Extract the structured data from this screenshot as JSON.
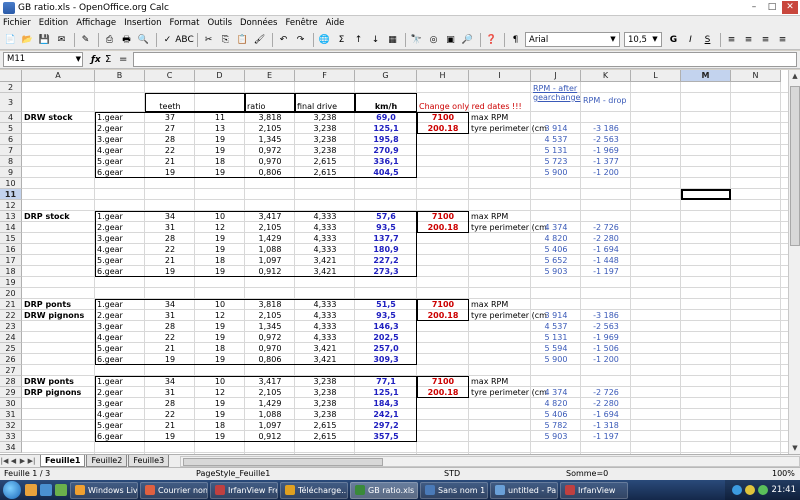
{
  "window": {
    "title": "GB ratio.xls - OpenOffice.org Calc"
  },
  "menu": [
    "Fichier",
    "Edition",
    "Affichage",
    "Insertion",
    "Format",
    "Outils",
    "Données",
    "Fenêtre",
    "Aide"
  ],
  "toolbar": {
    "font": "Arial",
    "size": "10,5",
    "bold": "G",
    "italic": "I",
    "underline": "S"
  },
  "namebox": {
    "value": "M11"
  },
  "formula": {
    "value": ""
  },
  "columns": [
    "A",
    "B",
    "C",
    "D",
    "E",
    "F",
    "G",
    "H",
    "I",
    "J",
    "K",
    "L",
    "M",
    "N"
  ],
  "selected_column": "M",
  "selected_row": "11",
  "rows": [
    "2",
    "3",
    "4",
    "5",
    "6",
    "7",
    "8",
    "9",
    "10",
    "11",
    "12",
    "13",
    "14",
    "15",
    "16",
    "17",
    "18",
    "19",
    "20",
    "21",
    "22",
    "23",
    "24",
    "25",
    "26",
    "27",
    "28",
    "29",
    "30",
    "31",
    "32",
    "33",
    "34"
  ],
  "headers": {
    "teeth": "teeth",
    "ratio": "ratio",
    "final_drive": "final drive",
    "kmh": "km/h",
    "change_only": "Change only red dates !!!",
    "rpm_after": "RPM - after gearchange",
    "rpm_drop": "RPM - drop"
  },
  "blocks": [
    {
      "title1": "DRW stock",
      "title2": "",
      "rows": [
        {
          "gear": "1.gear",
          "t1": "37",
          "t2": "11",
          "ratio": "3,818",
          "fd": "3,238",
          "kmh": "69,0",
          "h": "7100",
          "i": "max RPM",
          "j": "",
          "k": ""
        },
        {
          "gear": "2.gear",
          "t1": "27",
          "t2": "13",
          "ratio": "2,105",
          "fd": "3,238",
          "kmh": "125,1",
          "h": "200.18",
          "i": "tyre perimeter (cm",
          "j": "3 914",
          "k": "-3 186"
        },
        {
          "gear": "3.gear",
          "t1": "28",
          "t2": "19",
          "ratio": "1,345",
          "fd": "3,238",
          "kmh": "195,8",
          "h": "",
          "i": "",
          "j": "4 537",
          "k": "-2 563"
        },
        {
          "gear": "4.gear",
          "t1": "22",
          "t2": "19",
          "ratio": "0,972",
          "fd": "3,238",
          "kmh": "270,9",
          "h": "",
          "i": "",
          "j": "5 131",
          "k": "-1 969"
        },
        {
          "gear": "5.gear",
          "t1": "21",
          "t2": "18",
          "ratio": "0,970",
          "fd": "2,615",
          "kmh": "336,1",
          "h": "",
          "i": "",
          "j": "5 723",
          "k": "-1 377"
        },
        {
          "gear": "6.gear",
          "t1": "19",
          "t2": "19",
          "ratio": "0,806",
          "fd": "2,615",
          "kmh": "404,5",
          "h": "",
          "i": "",
          "j": "5 900",
          "k": "-1 200"
        }
      ]
    },
    {
      "title1": "DRP stock",
      "title2": "",
      "rows": [
        {
          "gear": "1.gear",
          "t1": "34",
          "t2": "10",
          "ratio": "3,417",
          "fd": "4,333",
          "kmh": "57,6",
          "h": "7100",
          "i": "max RPM",
          "j": "",
          "k": ""
        },
        {
          "gear": "2.gear",
          "t1": "31",
          "t2": "12",
          "ratio": "2,105",
          "fd": "4,333",
          "kmh": "93,5",
          "h": "200.18",
          "i": "tyre perimeter (cm",
          "j": "4 374",
          "k": "-2 726"
        },
        {
          "gear": "3.gear",
          "t1": "28",
          "t2": "19",
          "ratio": "1,429",
          "fd": "4,333",
          "kmh": "137,7",
          "h": "",
          "i": "",
          "j": "4 820",
          "k": "-2 280"
        },
        {
          "gear": "4.gear",
          "t1": "22",
          "t2": "19",
          "ratio": "1,088",
          "fd": "4,333",
          "kmh": "180,9",
          "h": "",
          "i": "",
          "j": "5 406",
          "k": "-1 694"
        },
        {
          "gear": "5.gear",
          "t1": "21",
          "t2": "18",
          "ratio": "1,097",
          "fd": "3,421",
          "kmh": "227,2",
          "h": "",
          "i": "",
          "j": "5 652",
          "k": "-1 448"
        },
        {
          "gear": "6.gear",
          "t1": "19",
          "t2": "19",
          "ratio": "0,912",
          "fd": "3,421",
          "kmh": "273,3",
          "h": "",
          "i": "",
          "j": "5 903",
          "k": "-1 197"
        }
      ]
    },
    {
      "title1": "DRP ponts",
      "title2": "DRW pignons",
      "rows": [
        {
          "gear": "1.gear",
          "t1": "34",
          "t2": "10",
          "ratio": "3,818",
          "fd": "4,333",
          "kmh": "51,5",
          "h": "7100",
          "i": "max RPM",
          "j": "",
          "k": ""
        },
        {
          "gear": "2.gear",
          "t1": "31",
          "t2": "12",
          "ratio": "2,105",
          "fd": "4,333",
          "kmh": "93,5",
          "h": "200.18",
          "i": "tyre perimeter (cm",
          "j": "3 914",
          "k": "-3 186"
        },
        {
          "gear": "3.gear",
          "t1": "28",
          "t2": "19",
          "ratio": "1,345",
          "fd": "4,333",
          "kmh": "146,3",
          "h": "",
          "i": "",
          "j": "4 537",
          "k": "-2 563"
        },
        {
          "gear": "4.gear",
          "t1": "22",
          "t2": "19",
          "ratio": "0,972",
          "fd": "4,333",
          "kmh": "202,5",
          "h": "",
          "i": "",
          "j": "5 131",
          "k": "-1 969"
        },
        {
          "gear": "5.gear",
          "t1": "21",
          "t2": "18",
          "ratio": "0,970",
          "fd": "3,421",
          "kmh": "257,0",
          "h": "",
          "i": "",
          "j": "5 594",
          "k": "-1 506"
        },
        {
          "gear": "6.gear",
          "t1": "19",
          "t2": "19",
          "ratio": "0,806",
          "fd": "3,421",
          "kmh": "309,3",
          "h": "",
          "i": "",
          "j": "5 900",
          "k": "-1 200"
        }
      ]
    },
    {
      "title1": "DRW ponts",
      "title2": "DRP pignons",
      "rows": [
        {
          "gear": "1.gear",
          "t1": "34",
          "t2": "10",
          "ratio": "3,417",
          "fd": "3,238",
          "kmh": "77,1",
          "h": "7100",
          "i": "max RPM",
          "j": "",
          "k": ""
        },
        {
          "gear": "2.gear",
          "t1": "31",
          "t2": "12",
          "ratio": "2,105",
          "fd": "3,238",
          "kmh": "125,1",
          "h": "200.18",
          "i": "tyre perimeter (cm",
          "j": "4 374",
          "k": "-2 726"
        },
        {
          "gear": "3.gear",
          "t1": "28",
          "t2": "19",
          "ratio": "1,429",
          "fd": "3,238",
          "kmh": "184,3",
          "h": "",
          "i": "",
          "j": "4 820",
          "k": "-2 280"
        },
        {
          "gear": "4.gear",
          "t1": "22",
          "t2": "19",
          "ratio": "1,088",
          "fd": "3,238",
          "kmh": "242,1",
          "h": "",
          "i": "",
          "j": "5 406",
          "k": "-1 694"
        },
        {
          "gear": "5.gear",
          "t1": "21",
          "t2": "18",
          "ratio": "1,097",
          "fd": "2,615",
          "kmh": "297,2",
          "h": "",
          "i": "",
          "j": "5 782",
          "k": "-1 318"
        },
        {
          "gear": "6.gear",
          "t1": "19",
          "t2": "19",
          "ratio": "0,912",
          "fd": "2,615",
          "kmh": "357,5",
          "h": "",
          "i": "",
          "j": "5 903",
          "k": "-1 197"
        }
      ]
    }
  ],
  "sheets": [
    "Feuille1",
    "Feuille2",
    "Feuille3"
  ],
  "active_sheet": "Feuille1",
  "status": {
    "sheet": "Feuille 1 / 3",
    "style": "PageStyle_Feuille1",
    "mode": "STD",
    "sum": "Somme=0",
    "zoom": "100%"
  },
  "taskbar": {
    "tasks": [
      "Windows Liv...",
      "Courrier non...",
      "IrfanView Fre...",
      "Télécharge...",
      "GB ratio.xls -...",
      "Sans nom 1 -...",
      "untitled - Pai...",
      "IrfanView"
    ],
    "active": "GB ratio.xls -...",
    "clock": "21:41"
  }
}
